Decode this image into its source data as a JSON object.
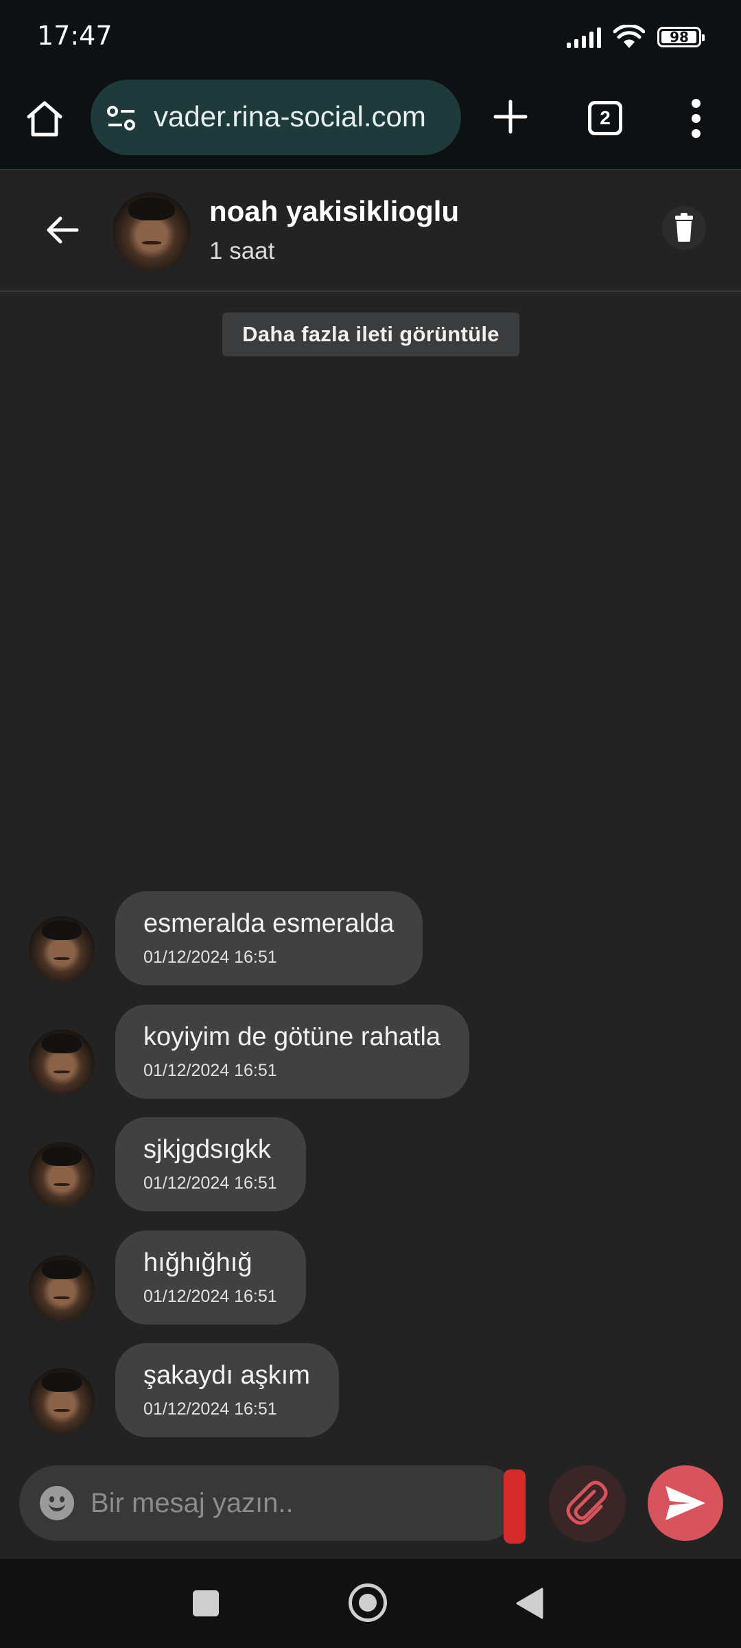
{
  "status_bar": {
    "time": "17:47",
    "battery": "98",
    "battery_level": 0.98,
    "icons": [
      "signal-icon",
      "wifi-icon",
      "battery-icon"
    ]
  },
  "browser": {
    "url": "vader.rina-social.com",
    "tab_count": "2",
    "icons": [
      "home-icon",
      "site-settings-icon",
      "new-tab-icon",
      "tabs-icon",
      "more-menu-icon"
    ]
  },
  "chat": {
    "contact_name": "noah yakisiklioglu",
    "contact_status": "1 saat",
    "load_more_label": "Daha fazla ileti görüntüle",
    "icons": [
      "back-arrow-icon",
      "trash-icon"
    ]
  },
  "messages": [
    {
      "text": "esmeralda esmeralda",
      "time": "01/12/2024 16:51"
    },
    {
      "text": "koyiyim de götüne rahatla",
      "time": "01/12/2024 16:51"
    },
    {
      "text": "sjkjgdsıgkk",
      "time": "01/12/2024 16:51"
    },
    {
      "text": "hığhığhığ",
      "time": "01/12/2024 16:51"
    },
    {
      "text": "şakaydı aşkım",
      "time": "01/12/2024 16:51"
    }
  ],
  "composer": {
    "placeholder": "Bir mesaj yazın..",
    "value": "",
    "icons": [
      "emoji-icon",
      "paperclip-icon",
      "send-icon"
    ],
    "accent": "#d9535d"
  },
  "nav": {
    "icons": [
      "recents-icon",
      "home-icon",
      "back-icon"
    ]
  }
}
